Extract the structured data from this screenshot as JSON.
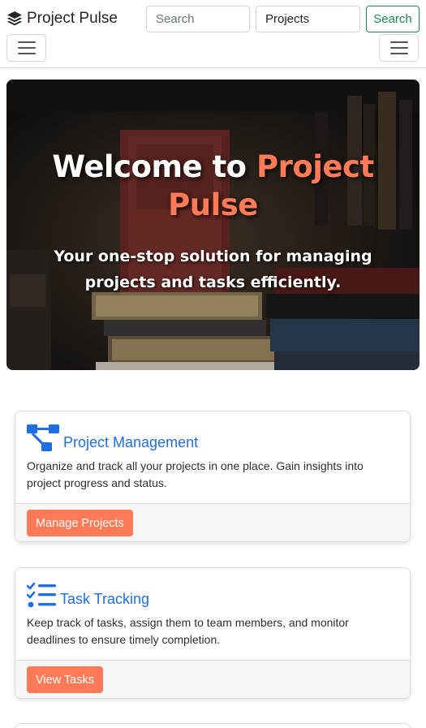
{
  "navbar": {
    "brand": "Project Pulse",
    "brand_icon": "layers-icon",
    "search_placeholder": "Search",
    "projects_value": "Projects",
    "search_button": "Search"
  },
  "hero": {
    "title_prefix": "Welcome to ",
    "title_accent": "Project Pulse",
    "subtitle": "Your one-stop solution for managing projects and tasks efficiently."
  },
  "cards": [
    {
      "icon": "diagram-icon",
      "title": "Project Management",
      "text": "Organize and track all your projects in one place. Gain insights into project progress and status.",
      "button": "Manage Projects"
    },
    {
      "icon": "checklist-icon",
      "title": "Task Tracking",
      "text": "Keep track of tasks, assign them to team members, and monitor deadlines to ensure timely completion.",
      "button": "View Tasks"
    }
  ],
  "colors": {
    "accent": "#ff7a57",
    "link": "#1e6ee6",
    "success": "#198754"
  }
}
